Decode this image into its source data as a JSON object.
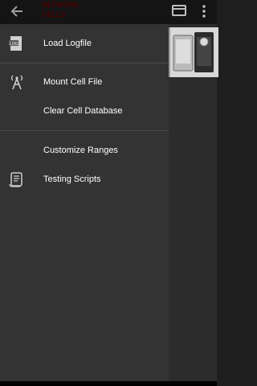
{
  "app": {
    "brand_text": "NETWORK\nCELLS",
    "icons": [
      "back-arrow-icon",
      "card-icon",
      "overflow-menu-icon"
    ]
  },
  "drawer": {
    "items": [
      {
        "label": "Load Logfile",
        "icon": "log-file-icon"
      },
      {
        "label": "Mount Cell File",
        "icon": "cell-tower-icon"
      },
      {
        "label": "Clear Cell Database",
        "icon": ""
      },
      {
        "label": "Customize Ranges",
        "icon": ""
      },
      {
        "label": "Testing Scripts",
        "icon": "script-scroll-icon"
      }
    ]
  },
  "colors": {
    "drawer_bg": "#333333",
    "topbar_bg": "#141414",
    "text": "#ffffff",
    "divider": "#4a4a4a"
  }
}
